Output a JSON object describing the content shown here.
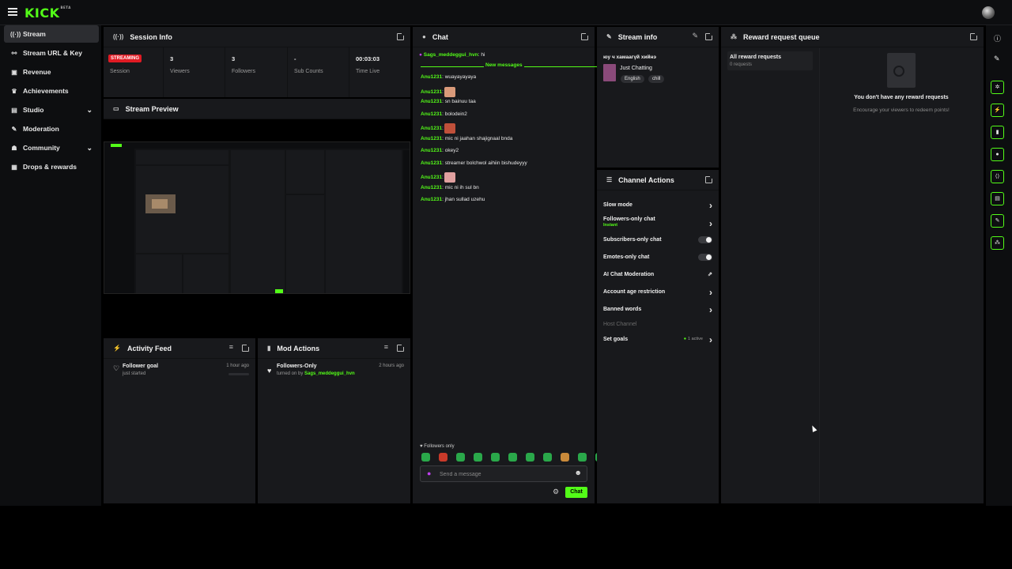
{
  "topbar": {
    "logo": "KICK",
    "logo_sup": "BETA"
  },
  "sidebar": {
    "items": [
      {
        "label": "Stream",
        "icon": "broadcast-icon",
        "glyph": "((·))",
        "active": true
      },
      {
        "label": "Stream URL & Key",
        "icon": "link-icon",
        "glyph": "⚯"
      },
      {
        "label": "Revenue",
        "icon": "revenue-icon",
        "glyph": "▣"
      },
      {
        "label": "Achievements",
        "icon": "trophy-icon",
        "glyph": "♛"
      },
      {
        "label": "Studio",
        "icon": "studio-icon",
        "glyph": "▤",
        "chevron": true
      },
      {
        "label": "Moderation",
        "icon": "wrench-icon",
        "glyph": "✎"
      },
      {
        "label": "Community",
        "icon": "community-icon",
        "glyph": "☗",
        "chevron": true
      },
      {
        "label": "Drops & rewards",
        "icon": "gift-icon",
        "glyph": "▦"
      }
    ]
  },
  "session": {
    "title": "Session Info",
    "badge": "STREAMING",
    "stats": [
      {
        "value": "",
        "label": "Session"
      },
      {
        "value": "3",
        "label": "Viewers"
      },
      {
        "value": "3",
        "label": "Followers"
      },
      {
        "value": "-",
        "label": "Sub Counts"
      },
      {
        "value": "00:03:03",
        "label": "Time Live"
      }
    ]
  },
  "preview": {
    "title": "Stream Preview"
  },
  "activity": {
    "title": "Activity Feed",
    "items": [
      {
        "title": "Follower goal",
        "sub": "just started",
        "time": "1 hour ago"
      }
    ]
  },
  "mod_actions": {
    "title": "Mod Actions",
    "items": [
      {
        "title": "Followers-Only",
        "sub_prefix": "turned on by",
        "user": "Sags_meddeggui_hvn",
        "time": "2 hours ago"
      }
    ]
  },
  "chat": {
    "title": "Chat",
    "pinned_user": "Sags_meddeggui_hvn",
    "pinned_text": ": hi",
    "new_messages": "New messages",
    "messages": [
      {
        "user": "Anu1231",
        "text": ": wuayayayaya"
      },
      {
        "user": "Anu1231",
        "text": ":",
        "emote": "#d99a7a"
      },
      {
        "user": "Anu1231",
        "text": ": sn bainuu taa"
      },
      {
        "user": "Anu1231",
        "text": ": bolodein2"
      },
      {
        "user": "Anu1231",
        "text": ":",
        "emote": "#c0503a"
      },
      {
        "user": "Anu1231",
        "text": ": mic ni jaahan shajignaal bnda"
      },
      {
        "user": "Anu1231",
        "text": ": okey2"
      },
      {
        "user": "Anu1231",
        "text": ": streamer bolchwol aihiin bishudeyyy"
      },
      {
        "user": "Anu1231",
        "text": ":",
        "emote": "#e0a0a0"
      },
      {
        "user": "Anu1231",
        "text": ": mic ni ih sul bn"
      },
      {
        "user": "Anu1231",
        "text": ": jhan sullad uzehu"
      }
    ],
    "followers_only": "Followers only",
    "emote_bar": [
      "#2aa84a",
      "#c93a2a",
      "#2aa84a",
      "#2aa84a",
      "#2aa84a",
      "#2aa84a",
      "#2aa84a",
      "#2aa84a",
      "#c98a3a",
      "#2aa84a",
      "#2aa84a"
    ],
    "input_placeholder": "Send a message",
    "send_label": "Chat"
  },
  "stream_info": {
    "title": "Stream info",
    "stream_title": "юу ч хамаагүй хийнэ",
    "category": "Just Chatting",
    "tags": [
      "English",
      "chill"
    ]
  },
  "channel_actions": {
    "title": "Channel Actions",
    "rows": [
      {
        "label": "Slow mode",
        "control": "chevron"
      },
      {
        "label": "Followers-only chat",
        "sub": "Instant",
        "control": "chevron"
      },
      {
        "label": "Subscribers-only chat",
        "control": "toggle"
      },
      {
        "label": "Emotes-only chat",
        "control": "toggle"
      },
      {
        "label": "AI Chat Moderation",
        "control": "external"
      },
      {
        "label": "Account age restriction",
        "control": "chevron"
      },
      {
        "label": "Banned words",
        "control": "chevron"
      },
      {
        "label": "Host Channel",
        "control": "none",
        "dim": true
      },
      {
        "label": "Set goals",
        "status": "1 active",
        "control": "chevron"
      }
    ]
  },
  "rewards": {
    "title": "Reward request queue",
    "list_title": "All reward requests",
    "list_count": "0 requests",
    "empty_title": "You don't have any reward requests",
    "empty_sub": "Encourage your viewers to redeem points!"
  },
  "rail": {
    "buttons": [
      "info-icon",
      "pencil-icon",
      "bug-icon",
      "bolt-icon",
      "doc-icon",
      "chat-bubble-icon",
      "broadcast-icon",
      "layout-icon",
      "wrench-icon",
      "users-icon"
    ]
  },
  "colors": {
    "accent": "#53fc18",
    "live": "#e01b24",
    "panel": "#18191c",
    "background": "#000000"
  }
}
